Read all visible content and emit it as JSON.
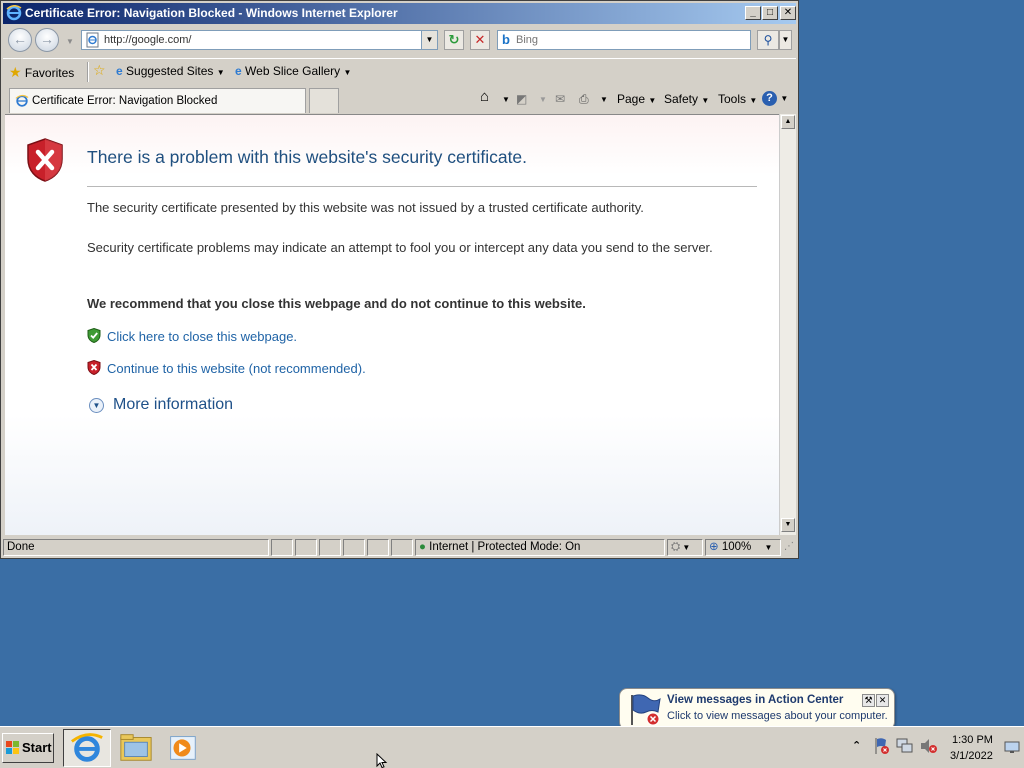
{
  "window": {
    "title": "Certificate Error: Navigation Blocked - Windows Internet Explorer",
    "minimize_glyph": "_",
    "maximize_glyph": "□",
    "close_glyph": "✕"
  },
  "navbar": {
    "back_glyph": "←",
    "forward_glyph": "→",
    "address": "http://google.com/",
    "refresh_glyph": "↻",
    "stop_glyph": "✕",
    "search_placeholder": "Bing",
    "search_logo": "b",
    "search_go_glyph": "⚲"
  },
  "favorites_bar": {
    "favorites": "Favorites",
    "suggested_sites": "Suggested Sites",
    "web_slice_gallery": "Web Slice Gallery"
  },
  "tabs": [
    {
      "label": "Certificate Error: Navigation Blocked"
    }
  ],
  "command_bar": {
    "page": "Page",
    "safety": "Safety",
    "tools": "Tools",
    "help_glyph": "?"
  },
  "page": {
    "title": "There is a problem with this website's security certificate.",
    "paragraph_1": "The security certificate presented by this website was not issued by a trusted certificate authority.",
    "paragraph_2": "Security certificate problems may indicate an attempt to fool you or intercept any data you send to the server.",
    "recommendation": "We recommend that you close this webpage and do not continue to this website.",
    "close_link": "Click here to close this webpage.",
    "continue_link": "Continue to this website (not recommended).",
    "more_info": "More information"
  },
  "status_bar": {
    "status": "Done",
    "zone": "Internet | Protected Mode: On",
    "zoom": "100%"
  },
  "notification": {
    "title": "View messages in Action Center",
    "subtitle": "Click to view messages about your computer."
  },
  "taskbar": {
    "start": "Start",
    "time": "1:30 PM",
    "date": "3/1/2022"
  },
  "icons": {
    "browser": "internet-explorer-icon",
    "error_shield": "shield-error-icon",
    "ok_shield": "shield-ok-icon",
    "zone": "globe-icon"
  },
  "colors": {
    "title_bar_start": "#0a246a",
    "title_bar_end": "#a6caf0",
    "desktop": "#3a6ea5",
    "error_title": "#1f4f7f",
    "link": "#1f63a6",
    "shield_red": "#c8202a",
    "shield_green": "#3f9b35"
  }
}
